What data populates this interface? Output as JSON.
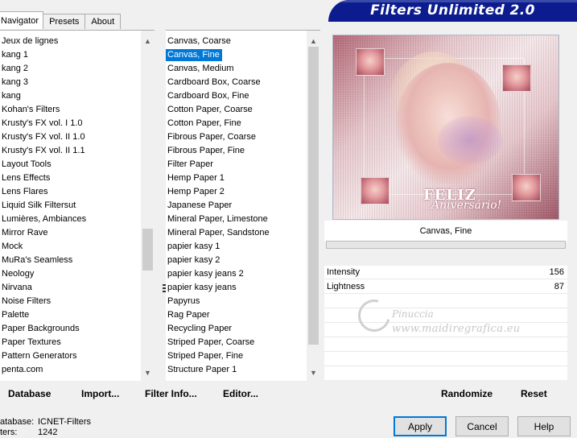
{
  "tabs": [
    {
      "label": "Navigator"
    },
    {
      "label": "Presets"
    },
    {
      "label": "About"
    }
  ],
  "title": "Filters Unlimited 2.0",
  "categories": [
    "Jeux de lignes",
    "kang 1",
    "kang 2",
    "kang 3",
    "kang",
    "Kohan's Filters",
    "Krusty's FX vol. I 1.0",
    "Krusty's FX vol. II 1.0",
    "Krusty's FX vol. II 1.1",
    "Layout Tools",
    "Lens Effects",
    "Lens Flares",
    "Liquid Silk Filtersut",
    "Lumières, Ambiances",
    "Mirror Rave",
    "Mock",
    "MuRa's Seamless",
    "Neology",
    "Nirvana",
    "Noise Filters",
    "Palette",
    "Paper Backgrounds",
    "Paper Textures",
    "Pattern Generators",
    "penta.com"
  ],
  "filters": [
    "Canvas, Coarse",
    "Canvas, Fine",
    "Canvas, Medium",
    "Cardboard Box, Coarse",
    "Cardboard Box, Fine",
    "Cotton Paper, Coarse",
    "Cotton Paper, Fine",
    "Fibrous Paper, Coarse",
    "Fibrous Paper, Fine",
    "Filter Paper",
    "Hemp Paper 1",
    "Hemp Paper 2",
    "Japanese Paper",
    "Mineral Paper, Limestone",
    "Mineral Paper, Sandstone",
    "papier kasy 1",
    "papier kasy 2",
    "papier kasy jeans 2",
    "papier kasy jeans",
    "Papyrus",
    "Rag Paper",
    "Recycling Paper",
    "Striped Paper, Coarse",
    "Striped Paper, Fine",
    "Structure Paper 1"
  ],
  "selected_filter_index": 1,
  "preview": {
    "text_line1": "FELIZ",
    "text_line2": "Aniversário!"
  },
  "current_filter": "Canvas, Fine",
  "params": [
    {
      "label": "Intensity",
      "value": "156"
    },
    {
      "label": "Lightness",
      "value": "87"
    }
  ],
  "watermark": {
    "line1": "Pinuccia",
    "line2": "www.maidiregrafica.eu"
  },
  "toolbar": {
    "database": "Database",
    "import": "Import...",
    "filter_info": "Filter Info...",
    "editor": "Editor...",
    "randomize": "Randomize",
    "reset": "Reset"
  },
  "stats": {
    "database_label": "atabase:",
    "database_value": "ICNET-Filters",
    "filters_label": "ters:",
    "filters_value": "1242"
  },
  "dialog": {
    "apply": "Apply",
    "cancel": "Cancel",
    "help": "Help"
  },
  "colors": {
    "banner": "#0c1c8f",
    "selection": "#0078d7",
    "background": "#f0f0f0"
  }
}
